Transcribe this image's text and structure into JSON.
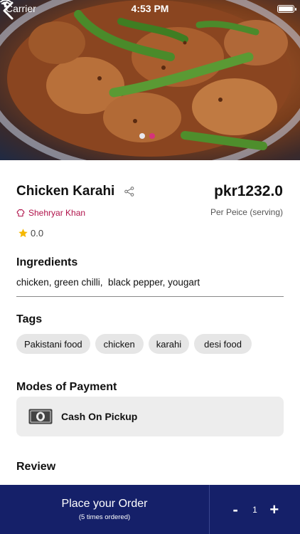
{
  "status_bar": {
    "carrier": "Carrier",
    "time": "4:53 PM"
  },
  "hero": {
    "image_name": "chicken-karahi-photo",
    "pagination": {
      "count": 2,
      "active": 1
    }
  },
  "dish": {
    "title": "Chicken Karahi",
    "price": "pkr1232.0",
    "chef": "Shehryar Khan",
    "unit": "Per Peice (serving)",
    "rating": "0.0"
  },
  "ingredients": {
    "heading": "Ingredients",
    "text": "chicken, green chilli,  black pepper, yougart"
  },
  "tags": {
    "heading": "Tags",
    "items": [
      "Pakistani food",
      "chicken",
      "karahi",
      "desi food"
    ]
  },
  "payment": {
    "heading": "Modes of Payment",
    "method": "Cash On Pickup",
    "icon": "cash-icon"
  },
  "review": {
    "heading": "Review"
  },
  "order_bar": {
    "label": "Place your Order",
    "subtext": "(5 times ordered)",
    "quantity": "1",
    "minus": "-",
    "plus": "+"
  },
  "colors": {
    "brand_navy": "#152069",
    "accent_pink": "#d6337a",
    "chef_red": "#b0124a",
    "star": "#f5b800"
  }
}
